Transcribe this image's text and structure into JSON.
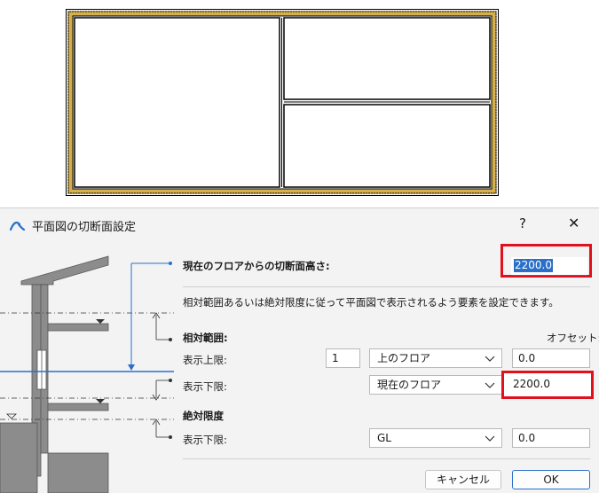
{
  "dialog": {
    "title": "平面図の切断面設定",
    "help_label": "?",
    "close_label": "✕",
    "cut_height_label": "現在のフロアからの切断面高さ:",
    "cut_height_value": "2200.0",
    "description": "相対範囲あるいは絶対限度に従って平面図で表示されるよう要素を設定できます。",
    "relative_section_title": "相対範囲:",
    "offset_header": "オフセット:",
    "upper_limit_label": "表示上限:",
    "upper_limit_floor_count": "1",
    "upper_limit_floor": "上のフロア",
    "upper_limit_offset": "0.0",
    "lower_limit_label": "表示下限:",
    "lower_limit_floor": "現在のフロア",
    "lower_limit_offset": "2200.0",
    "absolute_section_title": "絶対限度",
    "abs_lower_limit_label": "表示下限:",
    "abs_lower_limit_ref": "GL",
    "abs_lower_limit_offset": "0.0",
    "cancel_label": "キャンセル",
    "ok_label": "OK"
  },
  "colors": {
    "accent": "#2a6fc9",
    "highlight": "#e0101c",
    "plan_wall": "#c9a227"
  }
}
